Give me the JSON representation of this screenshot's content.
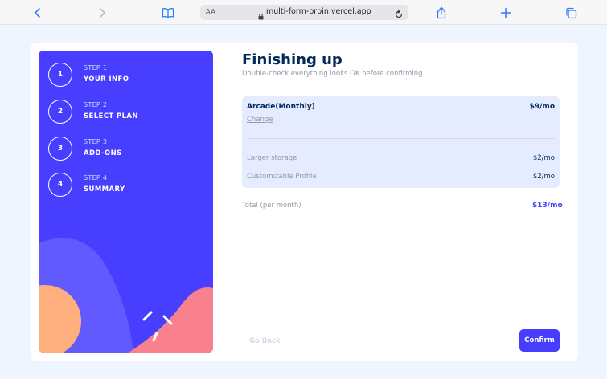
{
  "browser": {
    "text_size_label": "AA",
    "url": "multi-form-orpin.vercel.app"
  },
  "sidebar": {
    "steps": [
      {
        "number": "1",
        "label": "STEP 1",
        "name": "YOUR INFO"
      },
      {
        "number": "2",
        "label": "STEP 2",
        "name": "SELECT PLAN"
      },
      {
        "number": "3",
        "label": "STEP 3",
        "name": "ADD-ONS"
      },
      {
        "number": "4",
        "label": "STEP 4",
        "name": "SUMMARY"
      }
    ]
  },
  "main": {
    "title": "Finishing up",
    "subtitle": "Double-check everything looks OK before confirming.",
    "plan": {
      "name": "Arcade(Monthly)",
      "price": "$9/mo",
      "change_label": "Change"
    },
    "addons": [
      {
        "name": "Larger storage",
        "price": "$2/mo"
      },
      {
        "name": "Customizable Profile",
        "price": "$2/mo"
      }
    ],
    "total_label": "Total (per month)",
    "total_price": "$13/mo",
    "go_back_label": "Go Back",
    "confirm_label": "Confirm"
  },
  "colors": {
    "sidebar_bg": "#483eff",
    "accent": "#473dff",
    "heading": "#02295a",
    "muted": "#9699ab",
    "summary_bg": "#e6ecff"
  }
}
